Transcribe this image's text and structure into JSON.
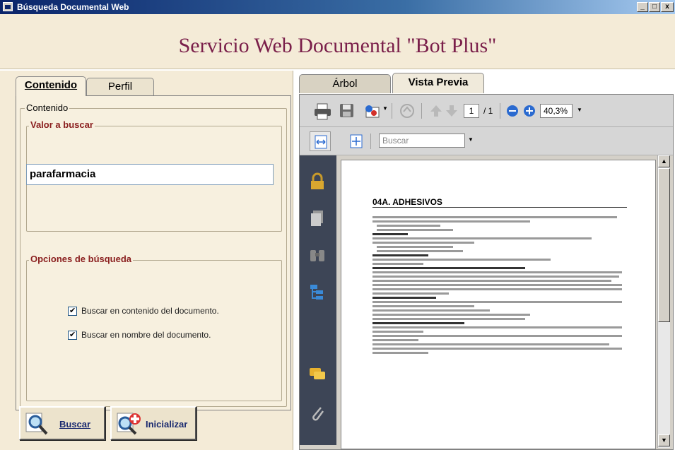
{
  "window": {
    "title": "Búsqueda Documental Web",
    "min": "_",
    "max": "□",
    "close": "x"
  },
  "header": {
    "title": "Servicio Web Documental \"Bot Plus\""
  },
  "left": {
    "tabs": [
      {
        "label": "Contenido"
      },
      {
        "label": "Perfil"
      }
    ],
    "group_title": "Contenido",
    "value_section": {
      "legend": "Valor a buscar",
      "input_value": "parafarmacia"
    },
    "options_section": {
      "legend": "Opciones de búsqueda",
      "options": [
        {
          "label": "Buscar en contenido del documento.",
          "checked": true
        },
        {
          "label": "Buscar en nombre del documento.",
          "checked": true
        }
      ]
    },
    "buttons": {
      "search": "Buscar",
      "reset": "Inicializar"
    }
  },
  "right": {
    "tabs": [
      {
        "label": "Árbol"
      },
      {
        "label": "Vista Previa"
      }
    ],
    "viewer": {
      "page_current": "1",
      "page_total": "/ 1",
      "zoom": "40,3%",
      "search_placeholder": "Buscar",
      "sidebar_icons": [
        "lock-icon",
        "pages-icon",
        "binoculars-icon",
        "tree-icon",
        "comment-icon",
        "attachment-icon"
      ],
      "doc": {
        "heading": "04A. ADHESIVOS",
        "subheads": [
          "ESPARADRAPOS",
          "Esparadrapos ordinarios:",
          "Adherentes.",
          "Esparadrapos hipoalérgicos",
          "Problemas dérmicos con los esparadrapos"
        ]
      }
    }
  }
}
